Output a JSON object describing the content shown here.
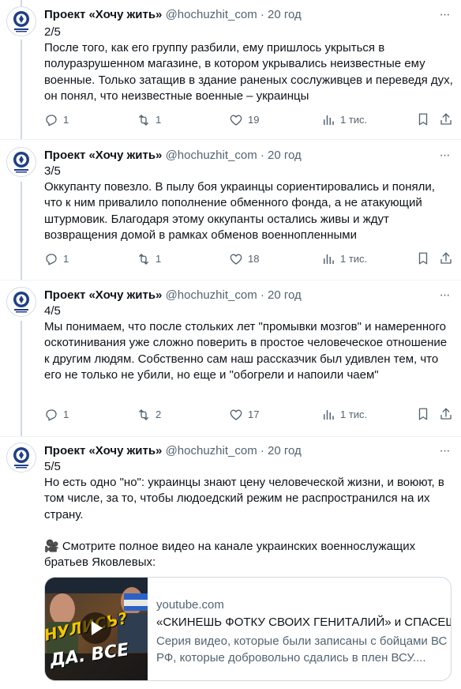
{
  "colors": {
    "text": "#0f1419",
    "muted": "#536471",
    "border": "#cfd9de"
  },
  "tweets": [
    {
      "author": "Проект «Хочу жить»",
      "handle": "@hochuzhit_com",
      "dot": "·",
      "time": "20 год",
      "text": "2/5\nПосле того, как его группу разбили, ему пришлось укрыться в полуразрушенном магазине, в котором укрывались неизвестные ему военные. Только затащив в здание раненых сослуживцев и переведя дух, он понял, что неизвестные военные – украинцы",
      "replies": "1",
      "retweets": "1",
      "likes": "19",
      "views": "1 тис."
    },
    {
      "author": "Проект «Хочу жить»",
      "handle": "@hochuzhit_com",
      "dot": "·",
      "time": "20 год",
      "text": "3/5\nОккупанту повезло. В пылу боя украинцы сориентировались и поняли, что к ним привалило пополнение обменного фонда, а не атакующий штурмовик. Благодаря этому оккупанты остались живы и ждут возвращения домой в рамках обменов военнопленными",
      "replies": "1",
      "retweets": "1",
      "likes": "18",
      "views": "1 тис."
    },
    {
      "author": "Проект «Хочу жить»",
      "handle": "@hochuzhit_com",
      "dot": "·",
      "time": "20 год",
      "text": "4/5\nМы понимаем, что после стольких лет \"промывки мозгов\" и намеренного оскотинивания уже сложно поверить в простое человеческое отношение к другим людям. Собственно сам наш рассказчик был удивлен тем, что его не только не убили, но еще и \"обогрели и напоили чаем\"",
      "replies": "1",
      "retweets": "2",
      "likes": "17",
      "views": "1 тис."
    },
    {
      "author": "Проект «Хочу жить»",
      "handle": "@hochuzhit_com",
      "dot": "·",
      "time": "20 год",
      "text": "5/5\nНо есть одно \"но\": украинцы знают цену человеческой жизни, и воюют, в том числе, за то, чтобы людоедский режим не распространился на их страну.\n\n🎥 Смотрите полное видео на канале украинских военнослужащих братьев Яковлевых:"
    }
  ],
  "card": {
    "domain": "youtube.com",
    "title": "«СКИНЕШЬ ФОТКУ СВОИХ ГЕНИТАЛИЙ» и СПАСЕШ",
    "description": "Серия видео, которые были записаны с бойцами ВС РФ, которые добровольно сдались в плен ВСУ....",
    "thumb_text_1": "НУЛИСЬ?",
    "thumb_text_2": "ДА. ВСЕ"
  },
  "icons": {
    "reply": "reply-icon",
    "retweet": "retweet-icon",
    "like": "heart-icon",
    "views": "views-icon",
    "bookmark": "bookmark-icon",
    "share": "share-icon",
    "more": "more-icon",
    "play": "play-icon"
  }
}
